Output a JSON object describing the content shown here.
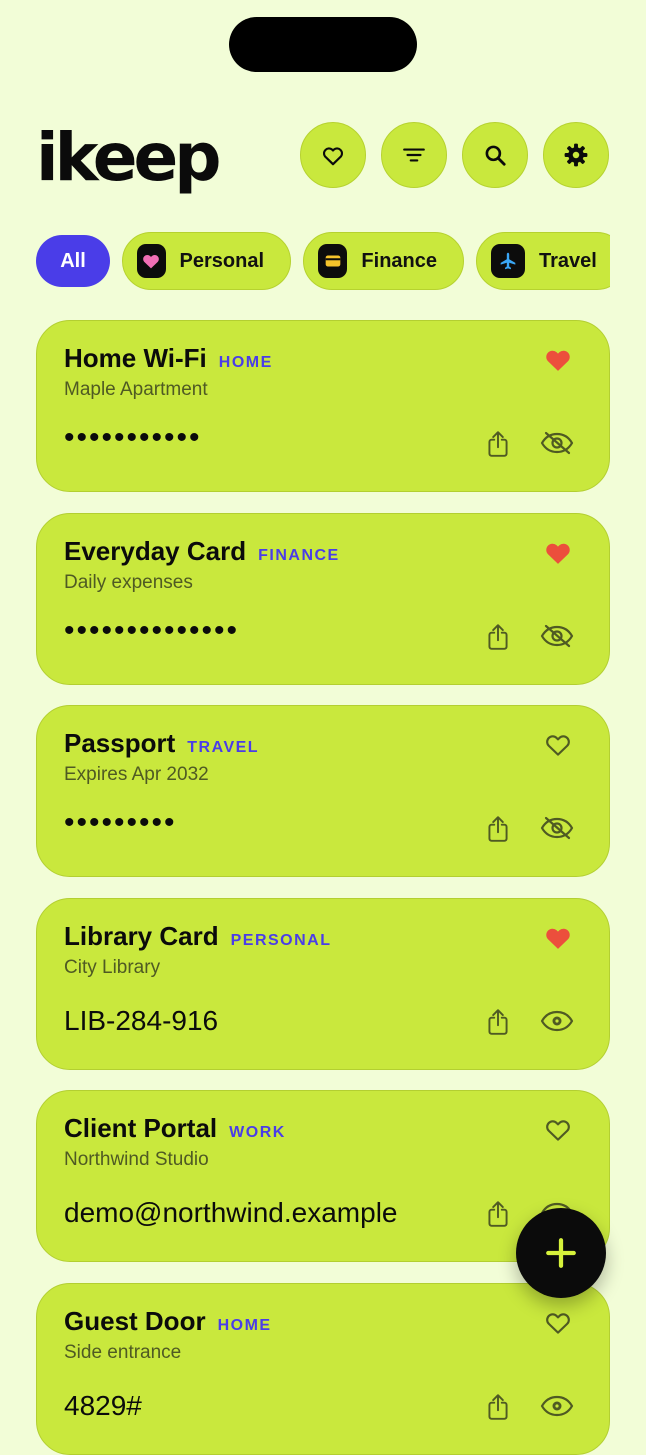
{
  "app": {
    "logo": "ikeep"
  },
  "header": {
    "buttons": [
      {
        "name": "favorites",
        "icon": "heart-outline-icon"
      },
      {
        "name": "filter",
        "icon": "filter-lines-icon"
      },
      {
        "name": "search",
        "icon": "search-icon"
      },
      {
        "name": "settings",
        "icon": "gear-icon"
      }
    ]
  },
  "filters": {
    "all": "All",
    "chips": [
      {
        "label": "Personal",
        "icon": "pink-heart-icon"
      },
      {
        "label": "Finance",
        "icon": "yellow-card-icon"
      },
      {
        "label": "Travel",
        "icon": "blue-plane-icon"
      }
    ]
  },
  "items": [
    {
      "title": "Home Wi-Fi",
      "tag": "HOME",
      "subtitle": "Maple Apartment",
      "secret": "•••••••••••",
      "hidden": true,
      "favorite": true
    },
    {
      "title": "Everyday Card",
      "tag": "FINANCE",
      "subtitle": "Daily expenses",
      "secret": "••••••••••••••",
      "hidden": true,
      "favorite": true
    },
    {
      "title": "Passport",
      "tag": "TRAVEL",
      "subtitle": "Expires Apr 2032",
      "secret": "•••••••••",
      "hidden": true,
      "favorite": false
    },
    {
      "title": "Library Card",
      "tag": "PERSONAL",
      "subtitle": "City Library",
      "secret": "LIB-284-916",
      "hidden": false,
      "favorite": true
    },
    {
      "title": "Client Portal",
      "tag": "WORK",
      "subtitle": "Northwind Studio",
      "secret": "demo@northwind.example",
      "hidden": false,
      "favorite": false
    },
    {
      "title": "Guest Door",
      "tag": "HOME",
      "subtitle": "Side entrance",
      "secret": "4829#",
      "hidden": false,
      "favorite": false
    }
  ],
  "colors": {
    "background": "#f2fdd7",
    "card": "#c9e83d",
    "accent": "#4a3de8",
    "favorite": "#ec4f3c",
    "fab": "#0b0b0b",
    "fab_icon": "#d6f23b"
  },
  "fab": {
    "icon": "plus-icon"
  }
}
